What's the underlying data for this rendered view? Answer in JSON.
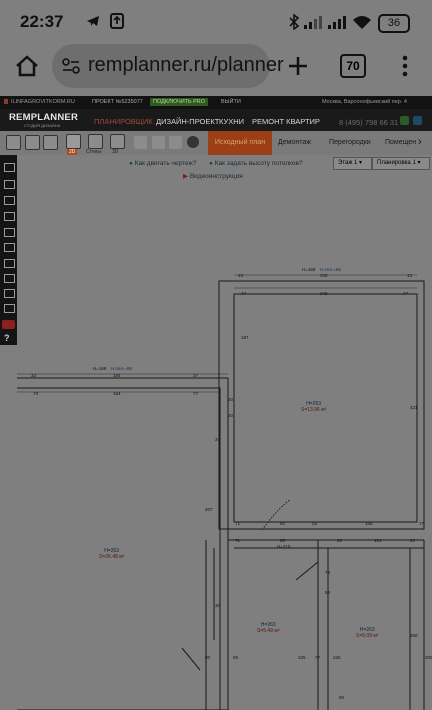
{
  "status_bar": {
    "time": "22:37",
    "battery": "36"
  },
  "browser": {
    "url": "remplanner.ru/planner",
    "tab_count": "70"
  },
  "site": {
    "email": "ILINFAGROVITKORM.RU",
    "project": "ПРОЕКТ №5235077",
    "pro_button": "ПОДКЛЮЧИТЬ PRO",
    "logout": "ВЫЙТИ",
    "address": "Москва, Варсонофьевский пер. 4",
    "phone": "8 (495) 798 66 31",
    "logo_main": "REMPLANNER",
    "logo_sub": "СТУДИЯ ДИЗАЙНА",
    "nav": [
      "ПЛАНИРОВЩИК",
      "ДИЗАЙН-ПРОЕКТ",
      "КУХНИ",
      "РЕМОНТ КВАРТИР"
    ],
    "toolbar": {
      "mode_labels": [
        "2D",
        "Стены",
        "3D"
      ],
      "tabs": [
        "Исходный план",
        "Демонтаж",
        "Перегородки",
        "Помещен"
      ]
    },
    "links": {
      "how_move": "Как двигать чертеж?",
      "how_height": "Как задать высоту потолков?",
      "video": "Видеоинструкция"
    },
    "selects": {
      "floor": "Этаж 1",
      "layout": "Планировка 1"
    }
  },
  "plan": {
    "rooms": [
      {
        "h": "H=263",
        "s": "S=13.96 м²"
      },
      {
        "h": "H=263",
        "s": "S=26.48 м²"
      },
      {
        "h": "H=263",
        "s": "S=5.49 м²"
      },
      {
        "h": "H=263",
        "s": "S=5.09 м²"
      }
    ],
    "wall_tags": {
      "top": "H=168",
      "top_area": "Н.пол.=65",
      "left": "H=168",
      "left_area": "Н.пол.=65",
      "mid": "H=210"
    },
    "dims": [
      "13",
      "340",
      "13",
      "47",
      "240",
      "47",
      "33",
      "194",
      "37",
      "78",
      "154",
      "77",
      "20",
      "187",
      "20",
      "421",
      "37",
      "71",
      "60",
      "26",
      "165",
      "77",
      "407",
      "467",
      "71",
      "60",
      "20",
      "121",
      "20",
      "225",
      "90",
      "90",
      "30",
      "73",
      "58",
      "77",
      "225",
      "300",
      "90",
      "300"
    ]
  }
}
